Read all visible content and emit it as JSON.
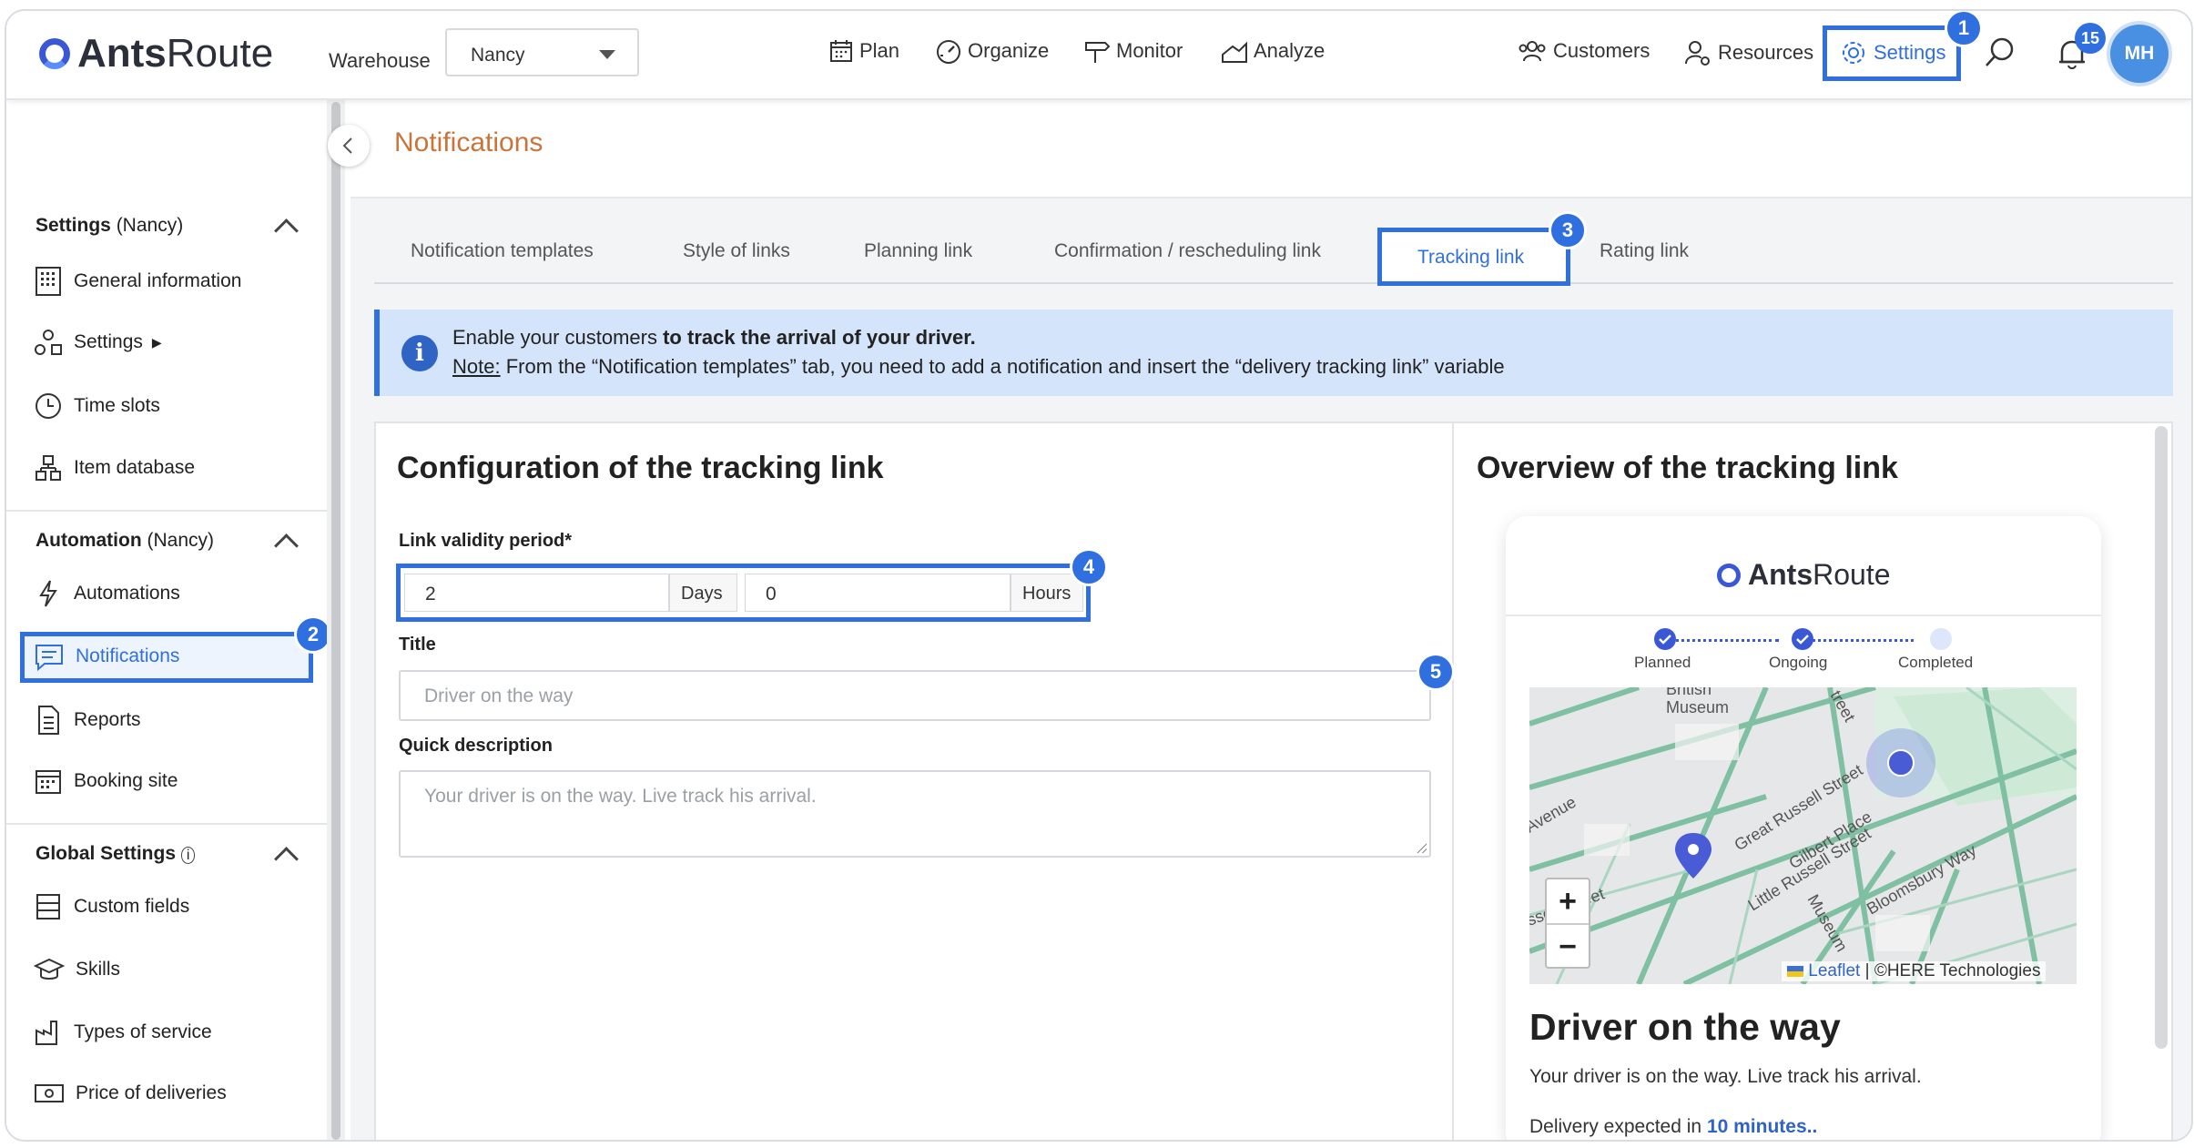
{
  "header": {
    "logo_text_bold": "Ants",
    "logo_text_light": "Route",
    "warehouse_label": "Warehouse",
    "warehouse_value": "Nancy",
    "nav": {
      "plan": "Plan",
      "organize": "Organize",
      "monitor": "Monitor",
      "analyze": "Analyze"
    },
    "right": {
      "customers": "Customers",
      "resources": "Resources",
      "settings": "Settings"
    },
    "notification_count": "15",
    "avatar_initials": "MH"
  },
  "step_badges": [
    "1",
    "2",
    "3",
    "4",
    "5"
  ],
  "sidebar": {
    "settings_section": {
      "title": "Settings",
      "scope": "(Nancy)"
    },
    "settings_items": [
      "General information",
      "Settings",
      "Time slots",
      "Item database"
    ],
    "automation_section": {
      "title": "Automation",
      "scope": "(Nancy)"
    },
    "automation_items": [
      "Automations",
      "Notifications",
      "Reports",
      "Booking site"
    ],
    "global_section": {
      "title": "Global Settings"
    },
    "global_items": [
      "Custom fields",
      "Skills",
      "Types of service",
      "Price of deliveries"
    ]
  },
  "page": {
    "title": "Notifications"
  },
  "tabs": [
    "Notification templates",
    "Style of links",
    "Planning link",
    "Confirmation / rescheduling link",
    "Tracking link",
    "Rating link"
  ],
  "active_tab": "Tracking link",
  "info": {
    "line1_prefix": "Enable your customers ",
    "line1_bold": "to track the arrival of your driver.",
    "line2_note": "Note:",
    "line2_text": " From the “Notification templates” tab, you need to add a notification and insert the “delivery tracking link” variable"
  },
  "config": {
    "heading": "Configuration of the tracking link",
    "validity_label": "Link validity period*",
    "days_value": "2",
    "days_unit": "Days",
    "hours_value": "0",
    "hours_unit": "Hours",
    "title_label": "Title",
    "title_placeholder": "Driver on the way",
    "desc_label": "Quick description",
    "desc_placeholder": "Your driver is on the way. Live track his arrival."
  },
  "overview": {
    "heading": "Overview of the tracking link",
    "logo_bold": "Ants",
    "logo_light": "Route",
    "steps": [
      "Planned",
      "Ongoing",
      "Completed"
    ],
    "map_labels": [
      "British",
      "Museum",
      "Great Russell Street",
      "Gilbert Place",
      "Little Russell Street",
      "Bloomsbury Way",
      "Museum",
      "ssell Street",
      "Avenue",
      "treet"
    ],
    "attribution_link": "Leaflet",
    "attribution_text": "| ©HERE Technologies",
    "title": "Driver on the way",
    "description": "Your driver is on the way. Live track his arrival.",
    "expected_prefix": "Delivery expected in ",
    "expected_value": "10 minutes.."
  }
}
